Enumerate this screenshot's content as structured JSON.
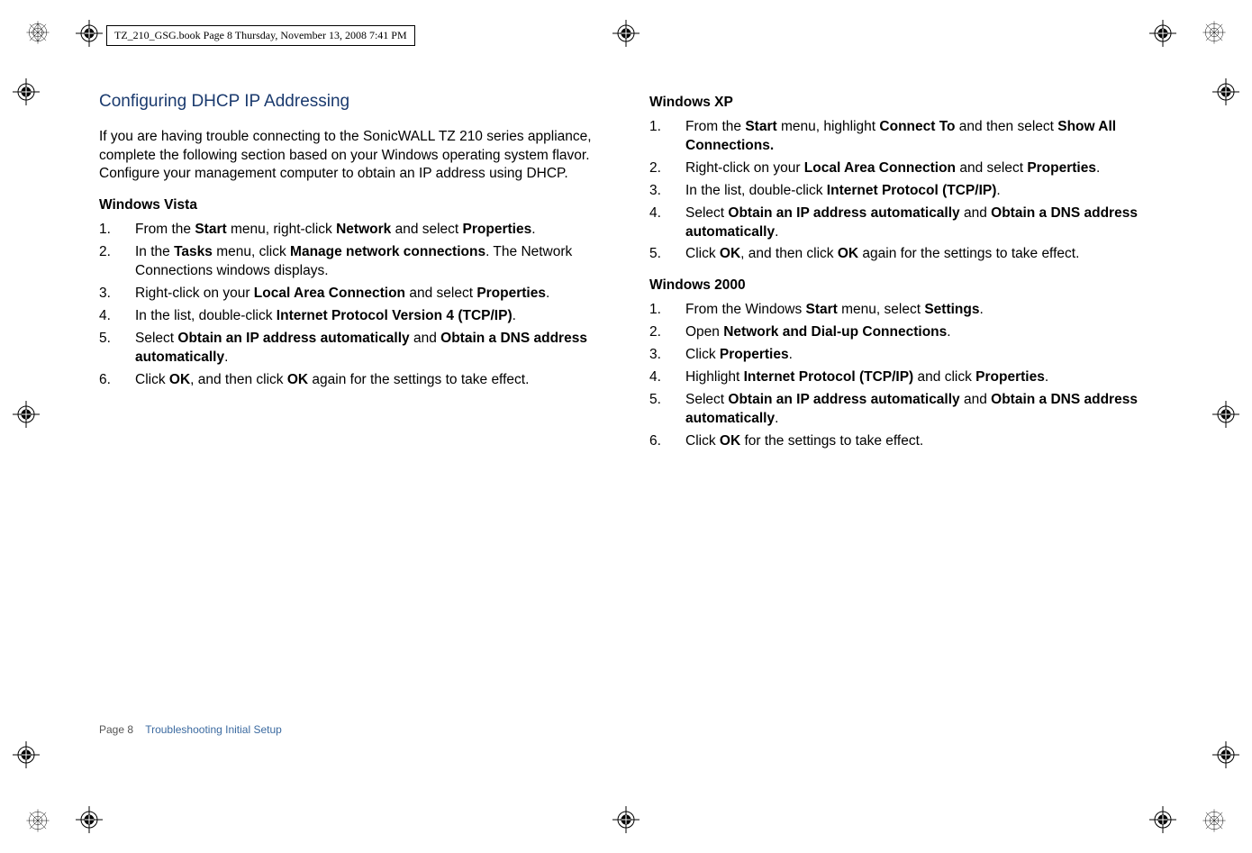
{
  "header": {
    "text": "TZ_210_GSG.book  Page 8  Thursday, November 13, 2008  7:41 PM"
  },
  "left": {
    "title": "Configuring DHCP IP Addressing",
    "intro": "If you are having trouble connecting to the SonicWALL TZ 210 series appliance, complete the following section based on your Windows operating system flavor. Configure your management computer to obtain an IP address using DHCP.",
    "vista": {
      "heading": "Windows Vista",
      "steps": {
        "s1a": "From the ",
        "s1b": "Start",
        "s1c": " menu, right-click ",
        "s1d": "Network",
        "s1e": " and select ",
        "s1f": "Properties",
        "s1g": ".",
        "s2a": "In the ",
        "s2b": "Tasks",
        "s2c": " menu, click ",
        "s2d": "Manage network connections",
        "s2e": ". The Network Connections windows displays.",
        "s3a": "Right-click on your ",
        "s3b": "Local Area Connection",
        "s3c": " and select ",
        "s3d": "Properties",
        "s3e": ".",
        "s4a": "In the list, double-click ",
        "s4b": "Internet Protocol Version 4 (TCP/IP)",
        "s4c": ".",
        "s5a": "Select ",
        "s5b": "Obtain an IP address automatically",
        "s5c": " and ",
        "s5d": "Obtain a DNS address automatically",
        "s5e": ".",
        "s6a": "Click ",
        "s6b": "OK",
        "s6c": ", and then click ",
        "s6d": "OK",
        "s6e": " again for the settings to take effect."
      }
    }
  },
  "right": {
    "xp": {
      "heading": "Windows XP",
      "steps": {
        "s1a": "From the ",
        "s1b": "Start",
        "s1c": " menu, highlight ",
        "s1d": "Connect To",
        "s1e": " and then select ",
        "s1f": "Show All Connections.",
        "s2a": "Right-click on your ",
        "s2b": "Local Area Connection",
        "s2c": " and select ",
        "s2d": "Properties",
        "s2e": ".",
        "s3a": "In the list, double-click ",
        "s3b": "Internet Protocol (TCP/IP)",
        "s3c": ".",
        "s4a": "Select ",
        "s4b": "Obtain an IP address automatically",
        "s4c": " and ",
        "s4d": "Obtain a DNS address automatically",
        "s4e": ".",
        "s5a": "Click ",
        "s5b": "OK",
        "s5c": ", and then click ",
        "s5d": "OK",
        "s5e": " again for the settings to take effect."
      }
    },
    "win2000": {
      "heading": "Windows 2000",
      "steps": {
        "s1a": "From the Windows ",
        "s1b": "Start",
        "s1c": " menu, select ",
        "s1d": "Settings",
        "s1e": ".",
        "s2a": "Open ",
        "s2b": "Network and Dial-up Connections",
        "s2c": ".",
        "s3a": "Click ",
        "s3b": "Properties",
        "s3c": ".",
        "s4a": "Highlight ",
        "s4b": "Internet Protocol (TCP/IP)",
        "s4c": " and click ",
        "s4d": "Properties",
        "s4e": ".",
        "s5a": "Select ",
        "s5b": "Obtain an IP address automatically",
        "s5c": " and ",
        "s5d": "Obtain a DNS address automatically",
        "s5e": ".",
        "s6a": "Click ",
        "s6b": "OK",
        "s6c": " for the settings to take effect."
      }
    }
  },
  "footer": {
    "page": "Page 8",
    "section": "Troubleshooting Initial Setup"
  }
}
